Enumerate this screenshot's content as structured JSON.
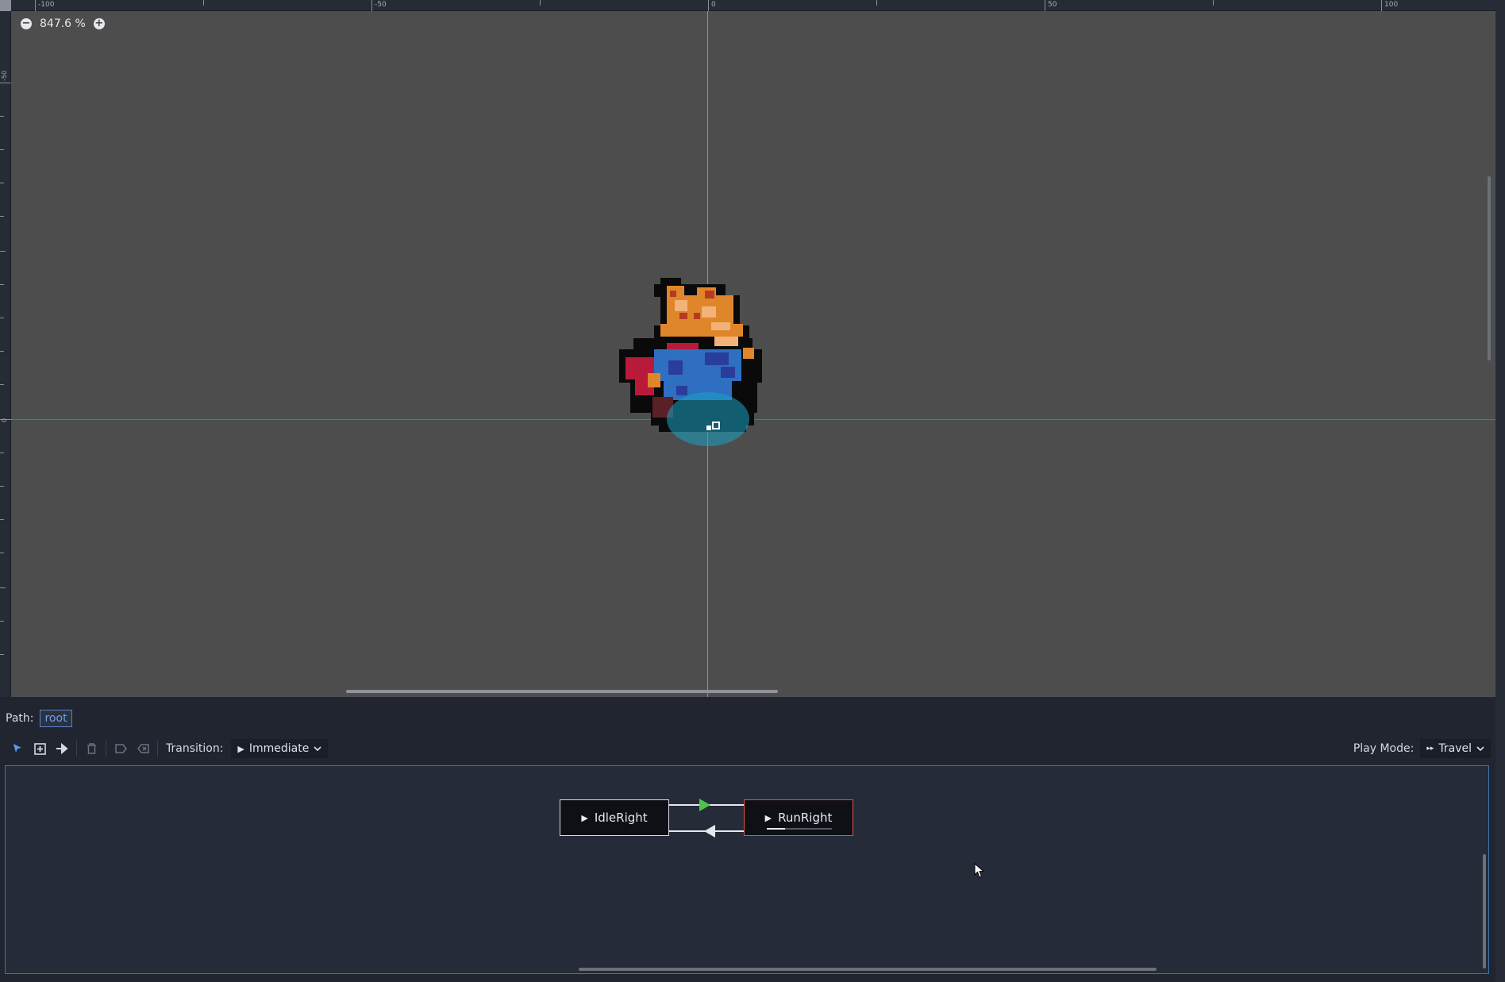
{
  "viewport": {
    "zoom_label": "847.6 %",
    "ruler_top_labels": [
      "-100",
      "-50",
      "0",
      "50",
      "100"
    ],
    "ruler_left_labels": [
      "-50",
      "0"
    ],
    "zoom_out_icon": "minus-circle-icon",
    "zoom_in_icon": "plus-circle-icon"
  },
  "path_bar": {
    "label": "Path:",
    "root": "root"
  },
  "toolbar": {
    "tools": [
      "select-icon",
      "create-node-icon",
      "connect-icon",
      "delete-icon",
      "end-icon",
      "remove-end-icon"
    ],
    "transition_label": "Transition:",
    "transition_value": "Immediate",
    "play_mode_label": "Play Mode:",
    "play_mode_value": "Travel"
  },
  "graph": {
    "nodes": [
      {
        "name": "IdleRight",
        "current": false
      },
      {
        "name": "RunRight",
        "current": true,
        "progress": 0.28
      }
    ],
    "colors": {
      "current_node_border": "#d9554f",
      "transition_arrow_active": "#4fc24a",
      "transition_arrow": "#e6e8ec"
    }
  }
}
